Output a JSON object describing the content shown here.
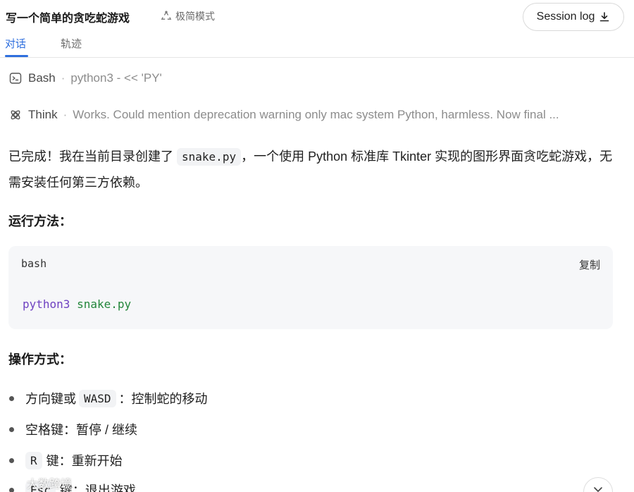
{
  "header": {
    "title": "写一个简单的贪吃蛇游戏",
    "mode_label": "极简模式",
    "session_button": "Session log"
  },
  "tabs": [
    {
      "label": "对话",
      "active": true
    },
    {
      "label": "轨迹",
      "active": false
    }
  ],
  "tool_calls": [
    {
      "icon": "terminal-icon",
      "name": "Bash",
      "separator": "·",
      "detail": "python3 - << 'PY'"
    },
    {
      "icon": "brain-icon",
      "name": "Think",
      "separator": "·",
      "detail": "Works. Could mention deprecation warning only mac system Python, harmless. Now final ..."
    }
  ],
  "message": {
    "part1": "已完成！我在当前目录创建了",
    "filename": "snake.py",
    "part2": "，一个使用 Python 标准库 Tkinter 实现的图形界面贪吃蛇游戏，无需安装任何第三方依赖。",
    "run_heading": "运行方法：",
    "code": {
      "lang": "bash",
      "copy_label": "复制",
      "command": "python3",
      "argument": "snake.py"
    },
    "ops_heading": "操作方式：",
    "bullets": [
      {
        "prefix": "方向键或",
        "code": "WASD",
        "suffix": "：控制蛇的移动"
      },
      {
        "prefix": "",
        "code": "",
        "suffix": "空格键：暂停 / 继续"
      },
      {
        "prefix": "",
        "code": "R",
        "suffix": "键：重新开始"
      },
      {
        "prefix": "",
        "code": "Esc",
        "suffix": "键：退出游戏"
      }
    ]
  },
  "watermark": "大数跨境",
  "colors": {
    "accent": "#2f6fde",
    "code_command": "#6f42c1",
    "code_argument": "#22863a",
    "code_bg": "#f6f7f9"
  }
}
